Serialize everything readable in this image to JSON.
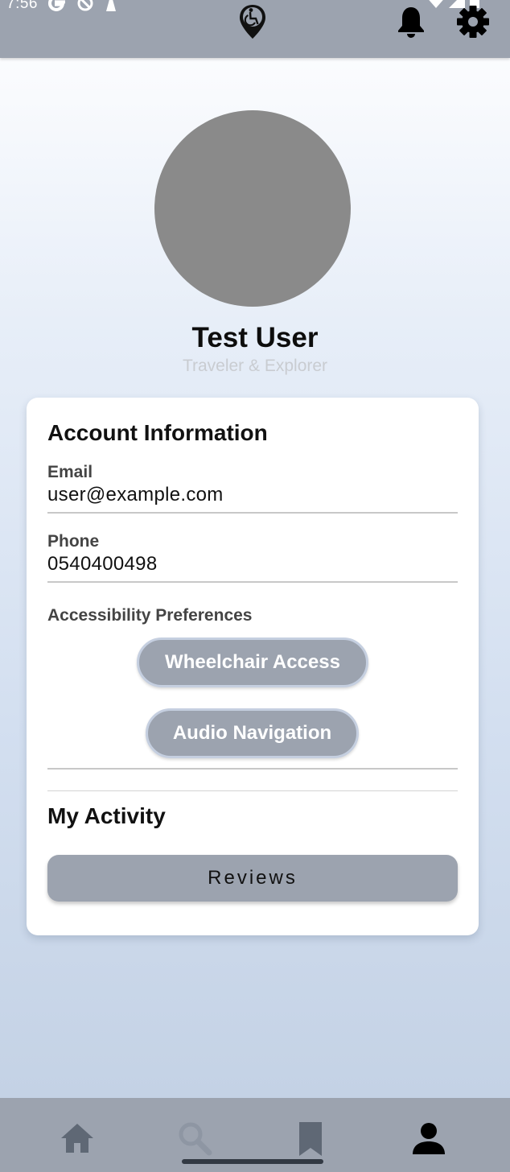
{
  "status_bar": {
    "time": "7:56"
  },
  "top_bar": {
    "logo_icon": "accessible-pin-icon",
    "notifications_icon": "bell-icon",
    "settings_icon": "gear-icon"
  },
  "profile": {
    "name": "Test User",
    "subtitle": "Traveler & Explorer",
    "avatar_color": "#8a8a8a"
  },
  "account": {
    "title": "Account Information",
    "email_label": "Email",
    "email_value": "user@example.com",
    "phone_label": "Phone",
    "phone_value": "0540400498",
    "preferences_label": "Accessibility Preferences",
    "preferences": [
      "Wheelchair Access",
      "Audio Navigation"
    ]
  },
  "activity": {
    "title": "My Activity",
    "reviews_label": "Reviews"
  },
  "bottom_nav": {
    "items": [
      {
        "name": "home",
        "icon": "home-icon"
      },
      {
        "name": "search",
        "icon": "search-icon"
      },
      {
        "name": "saved",
        "icon": "bookmark-icon"
      },
      {
        "name": "profile",
        "icon": "person-icon",
        "active": true
      }
    ]
  },
  "colors": {
    "bar": "#9ca3af",
    "chip_border": "#c5cfe0",
    "active_icon": "#000000",
    "inactive_icon": "#5f6875"
  }
}
